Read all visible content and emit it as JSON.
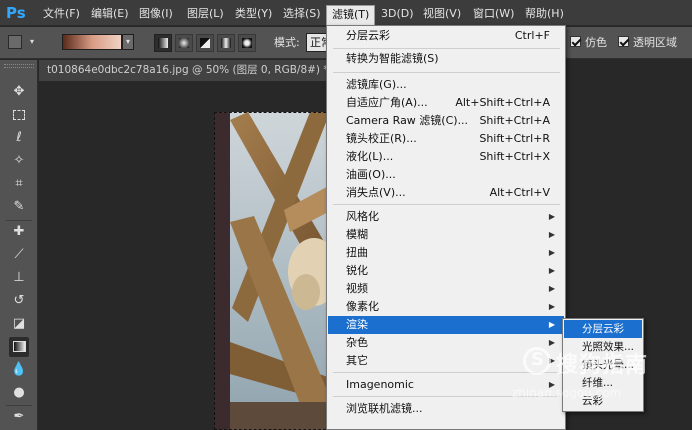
{
  "app": {
    "logo": "Ps",
    "menubar": [
      {
        "label": "文件(F)"
      },
      {
        "label": "编辑(E)"
      },
      {
        "label": "图像(I)"
      },
      {
        "label": "图层(L)"
      },
      {
        "label": "类型(Y)"
      },
      {
        "label": "选择(S)"
      },
      {
        "label": "滤镜(T)",
        "active": true
      },
      {
        "label": "3D(D)"
      },
      {
        "label": "视图(V)"
      },
      {
        "label": "窗口(W)"
      },
      {
        "label": "帮助(H)"
      }
    ]
  },
  "options_bar": {
    "mode_label": "模式:",
    "mode_value": "正常",
    "dither_label": "仿色",
    "transparency_label": "透明区域",
    "dither_checked": true,
    "transparency_checked": true
  },
  "document": {
    "tab_title": "t010864e0dbc2c78a16.jpg @ 50% (图层 0, RGB/8#) *",
    "close_glyph": "×"
  },
  "filter_menu": {
    "items": [
      {
        "label": "分层云彩",
        "shortcut": "Ctrl+F"
      },
      {
        "sep": true
      },
      {
        "label": "转换为智能滤镜(S)"
      },
      {
        "sep": true
      },
      {
        "label": "滤镜库(G)..."
      },
      {
        "label": "自适应广角(A)...",
        "shortcut": "Alt+Shift+Ctrl+A"
      },
      {
        "label": "Camera Raw 滤镜(C)...",
        "shortcut": "Shift+Ctrl+A"
      },
      {
        "label": "镜头校正(R)...",
        "shortcut": "Shift+Ctrl+R"
      },
      {
        "label": "液化(L)...",
        "shortcut": "Shift+Ctrl+X"
      },
      {
        "label": "油画(O)..."
      },
      {
        "label": "消失点(V)...",
        "shortcut": "Alt+Ctrl+V"
      },
      {
        "sep": true
      },
      {
        "label": "风格化",
        "submenu": true
      },
      {
        "label": "模糊",
        "submenu": true
      },
      {
        "label": "扭曲",
        "submenu": true
      },
      {
        "label": "锐化",
        "submenu": true
      },
      {
        "label": "视频",
        "submenu": true
      },
      {
        "label": "像素化",
        "submenu": true
      },
      {
        "label": "渲染",
        "submenu": true,
        "highlighted": true
      },
      {
        "label": "杂色",
        "submenu": true
      },
      {
        "label": "其它",
        "submenu": true
      },
      {
        "sep": true
      },
      {
        "label": "Imagenomic",
        "submenu": true
      },
      {
        "sep": true
      },
      {
        "label": "浏览联机滤镜..."
      }
    ]
  },
  "render_submenu": {
    "items": [
      {
        "label": "分层云彩",
        "highlighted": true
      },
      {
        "label": "光照效果..."
      },
      {
        "label": "镜头光晕..."
      },
      {
        "label": "纤维..."
      },
      {
        "label": "云彩"
      }
    ]
  },
  "watermark": {
    "logo_letter": "S",
    "text": "搜狗指南",
    "url": "zhinan.sogou.com"
  },
  "colors": {
    "menu_highlight": "#1b6fcf",
    "ps_blue": "#31a8ff",
    "panel_gray": "#535353"
  }
}
